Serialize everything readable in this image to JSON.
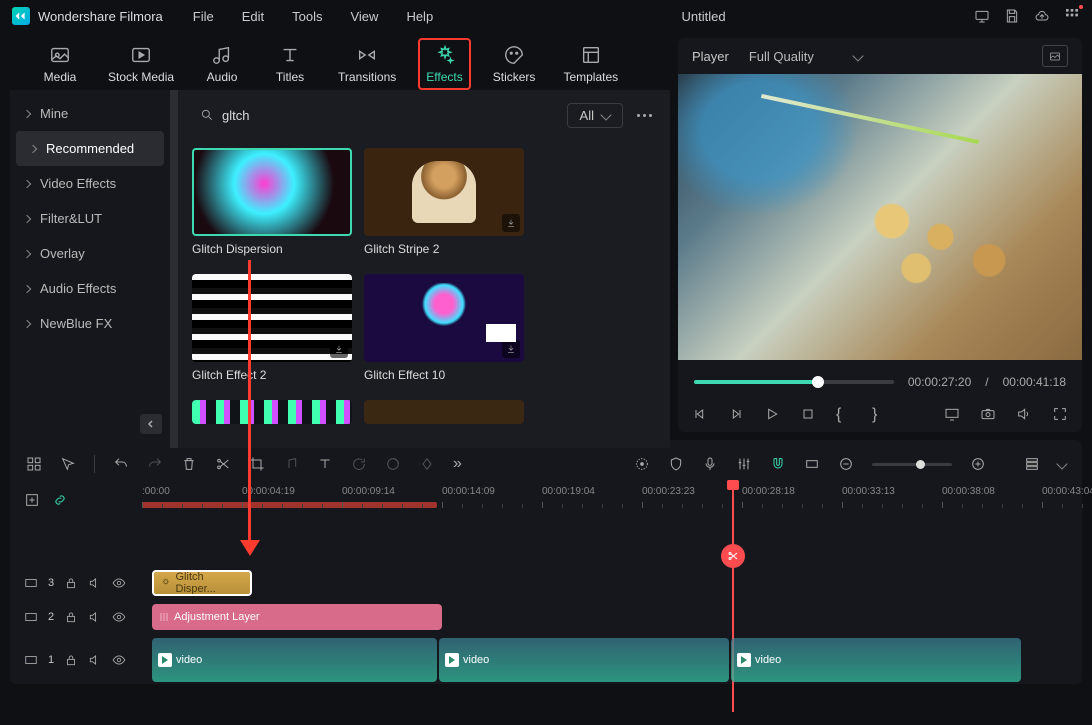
{
  "app": {
    "name": "Wondershare Filmora",
    "document": "Untitled"
  },
  "menu": {
    "file": "File",
    "edit": "Edit",
    "tools": "Tools",
    "view": "View",
    "help": "Help"
  },
  "tabs": {
    "media": "Media",
    "stock": "Stock Media",
    "audio": "Audio",
    "titles": "Titles",
    "transitions": "Transitions",
    "effects": "Effects",
    "stickers": "Stickers",
    "templates": "Templates"
  },
  "sidebar": {
    "items": [
      "Mine",
      "Recommended",
      "Video Effects",
      "Filter&LUT",
      "Overlay",
      "Audio Effects",
      "NewBlue FX"
    ],
    "active": 1
  },
  "search": {
    "value": "gltch",
    "filter": "All"
  },
  "effects": [
    {
      "name": "Glitch Dispersion",
      "selected": true,
      "cls": "th1"
    },
    {
      "name": "Glitch Stripe 2",
      "downloadable": true,
      "cls": "th2"
    },
    {
      "name": "Glitch Effect 2",
      "downloadable": true,
      "cls": "th3"
    },
    {
      "name": "Glitch Effect 10",
      "downloadable": true,
      "cls": "th4"
    },
    {
      "name": "",
      "cls": "th5"
    },
    {
      "name": "",
      "cls": "th6"
    }
  ],
  "player": {
    "label": "Player",
    "quality": "Full Quality",
    "current": "00:00:27:20",
    "sep": "/",
    "total": "00:00:41:18"
  },
  "ruler": {
    "ticks": [
      ":00:00",
      "00:00:04:19",
      "00:00:09:14",
      "00:00:14:09",
      "00:00:19:04",
      "00:00:23:23",
      "00:00:28:18",
      "00:00:33:13",
      "00:00:38:08",
      "00:00:43:04"
    ]
  },
  "tracks": {
    "t3": {
      "idx": "3",
      "clip": "Glitch Disper..."
    },
    "t2": {
      "idx": "2",
      "clip": "Adjustment Layer"
    },
    "t1": {
      "idx": "1",
      "clips": [
        "video",
        "video",
        "video"
      ]
    }
  }
}
